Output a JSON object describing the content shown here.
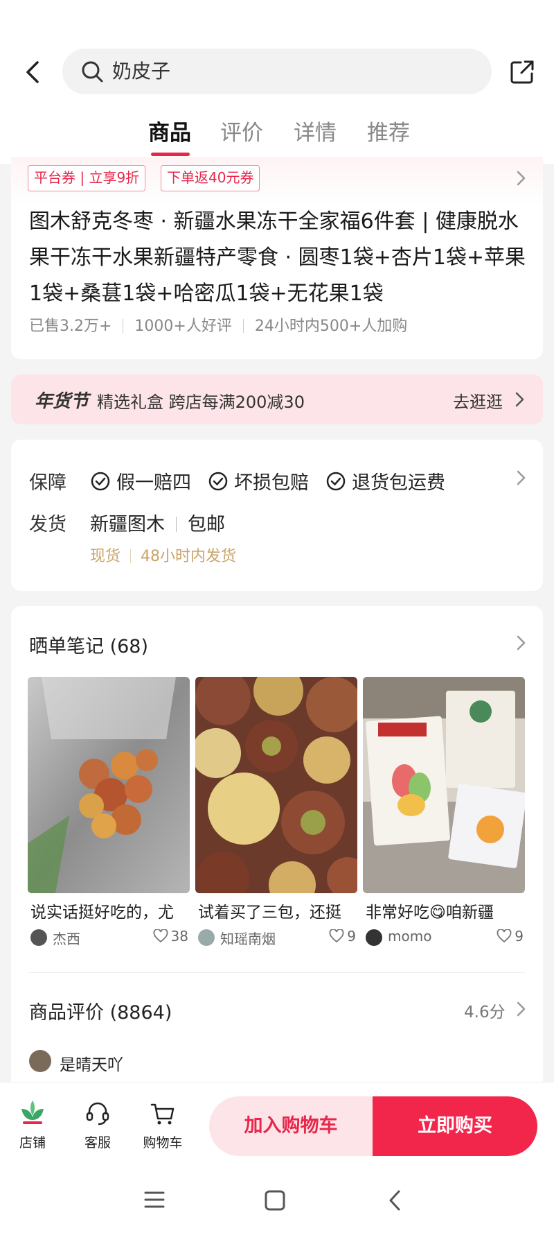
{
  "search": {
    "query": "奶皮子"
  },
  "tabs": [
    {
      "label": "商品",
      "active": true
    },
    {
      "label": "评价",
      "active": false
    },
    {
      "label": "详情",
      "active": false
    },
    {
      "label": "推荐",
      "active": false
    }
  ],
  "coupons": [
    "平台券 | 立享9折",
    "下单返40元券"
  ],
  "product": {
    "title": "图木舒克冬枣 · 新疆水果冻干全家福6件套 | 健康脱水果干冻干水果新疆特产零食 · 圆枣1袋+杏片1袋+苹果1袋+桑葚1袋+哈密瓜1袋+无花果1袋",
    "stats": [
      "已售3.2万+",
      "1000+人好评",
      "24小时内500+人加购"
    ]
  },
  "promo": {
    "logo": "年货节",
    "text": "精选礼盒 跨店每满200减30",
    "link": "去逛逛"
  },
  "guarantee": {
    "label": "保障",
    "items": [
      "假一赔四",
      "坏损包赔",
      "退货包运费"
    ]
  },
  "shipping": {
    "label": "发货",
    "origin": "新疆图木",
    "fee": "包邮",
    "stock": "现货",
    "time": "48小时内发货"
  },
  "notes": {
    "title": "晒单笔记 (68)",
    "items": [
      {
        "caption": "说实话挺好吃的，尤",
        "author": "杰西",
        "likes": "38"
      },
      {
        "caption": "试着买了三包，还挺",
        "author": "知瑶南烟",
        "likes": "9"
      },
      {
        "caption": "非常好吃😋咱新疆",
        "author": "momo",
        "likes": "9"
      }
    ]
  },
  "reviews": {
    "title": "商品评价 (8864)",
    "rating": "4.6分",
    "first_reviewer": "是晴天吖"
  },
  "bottom_bar": {
    "shop": "店铺",
    "service": "客服",
    "cart": "购物车",
    "add_to_cart": "加入购物车",
    "buy_now": "立即购买"
  },
  "colors": {
    "accent": "#e8264a",
    "promo_bg": "#fde4e8",
    "ship_sub": "#c9a46b"
  }
}
